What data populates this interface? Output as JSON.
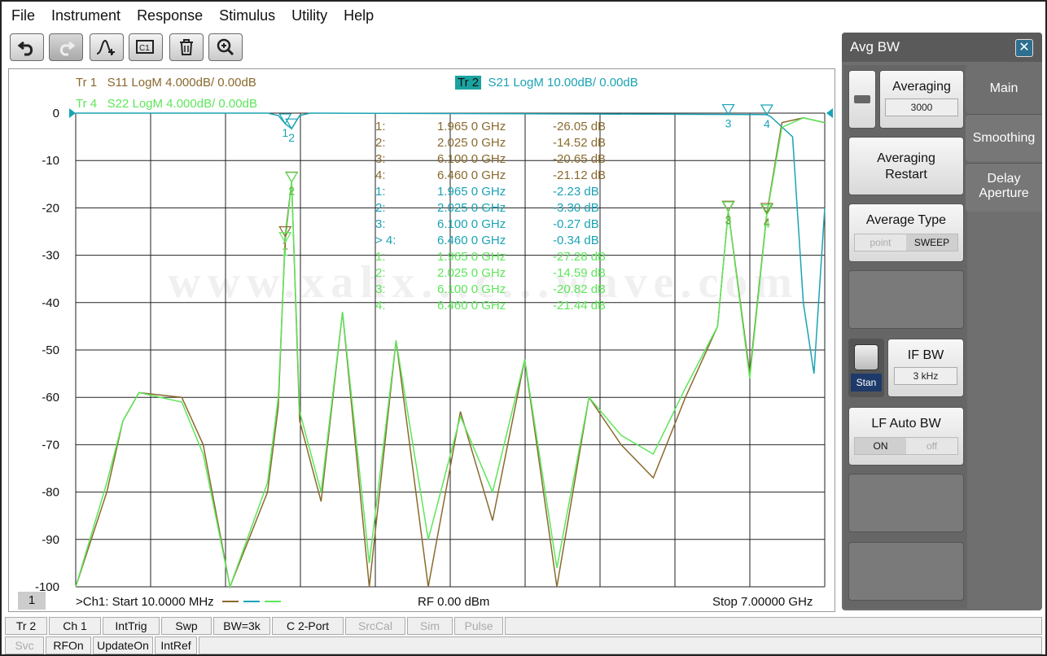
{
  "menu": [
    "File",
    "Instrument",
    "Response",
    "Stimulus",
    "Utility",
    "Help"
  ],
  "toolbar": {
    "icons": [
      "undo-icon",
      "redo-icon",
      "marker-add-icon",
      "calibration-icon",
      "trash-icon",
      "zoom-icon"
    ]
  },
  "colors": {
    "s11": "#8a6a2e",
    "s21": "#1aa3b5",
    "s22": "#5ee65a",
    "grid": "#222222",
    "tr2_badge": "#1aa3a0"
  },
  "traces": {
    "tr1": {
      "id": "Tr  1",
      "label": "S11 LogM 4.000dB/  0.00dB"
    },
    "tr2": {
      "id": "Tr  2",
      "label": "S21 LogM 10.00dB/  0.00dB"
    },
    "tr4": {
      "id": "Tr  4",
      "label": "S22 LogM 4.000dB/  0.00dB"
    }
  },
  "chart_data": {
    "type": "line",
    "xlim": [
      0.01,
      7.0
    ],
    "ylim": [
      -100,
      0
    ],
    "y_ticks": [
      "0",
      "-10",
      "-20",
      "-30",
      "-40",
      "-50",
      "-60",
      "-70",
      "-80",
      "-90",
      "-100"
    ],
    "grid": true,
    "series": [
      {
        "name": "S11",
        "x": [
          0.01,
          0.3,
          0.45,
          0.6,
          1.0,
          1.2,
          1.45,
          1.8,
          1.9,
          1.965,
          2.025,
          2.1,
          2.3,
          2.5,
          2.75,
          3.0,
          3.3,
          3.6,
          3.9,
          4.2,
          4.5,
          4.8,
          5.1,
          5.4,
          5.7,
          6.0,
          6.1,
          6.3,
          6.46,
          6.6,
          6.8,
          7.0
        ],
        "values": [
          -100,
          -80,
          -65,
          -59,
          -60,
          -70,
          -100,
          -80,
          -62,
          -26.05,
          -14.52,
          -65,
          -82,
          -42,
          -100,
          -48,
          -100,
          -63,
          -86,
          -52,
          -100,
          -60,
          -70,
          -77,
          -60,
          -45,
          -20.65,
          -55,
          -21.12,
          -2,
          -1,
          -2
        ]
      },
      {
        "name": "S21",
        "x": [
          0.01,
          1.8,
          1.9,
          1.965,
          2.025,
          2.1,
          2.2,
          6.1,
          6.3,
          6.4,
          6.46,
          6.5,
          6.7,
          6.8,
          6.9,
          7.0
        ],
        "values": [
          0,
          0,
          -0.5,
          -2.23,
          -3.3,
          -0.5,
          0,
          -0.27,
          -0.3,
          -0.3,
          -0.34,
          -0.8,
          -5,
          -40,
          -55,
          -20
        ]
      },
      {
        "name": "S22",
        "x": [
          0.01,
          0.3,
          0.45,
          0.6,
          1.0,
          1.2,
          1.45,
          1.8,
          1.9,
          1.965,
          2.025,
          2.1,
          2.3,
          2.5,
          2.75,
          3.0,
          3.3,
          3.6,
          3.9,
          4.2,
          4.5,
          4.8,
          5.1,
          5.4,
          5.7,
          6.0,
          6.1,
          6.3,
          6.46,
          6.6,
          6.8,
          7.0
        ],
        "values": [
          -100,
          -78,
          -65,
          -59,
          -61,
          -72,
          -100,
          -78,
          -60,
          -27.28,
          -14.59,
          -63,
          -80,
          -42,
          -95,
          -48,
          -90,
          -64,
          -80,
          -52,
          -96,
          -60,
          -68,
          -72,
          -58,
          -45,
          -20.82,
          -56,
          -21.44,
          -3,
          -1,
          -2
        ]
      }
    ]
  },
  "markers": [
    {
      "num": "1:",
      "freq": "1.965 0 GHz",
      "val": "-26.05 dB",
      "trace": "s11"
    },
    {
      "num": "2:",
      "freq": "2.025 0 GHz",
      "val": "-14.52 dB",
      "trace": "s11"
    },
    {
      "num": "3:",
      "freq": "6.100 0 GHz",
      "val": "-20.65 dB",
      "trace": "s11"
    },
    {
      "num": "4:",
      "freq": "6.460 0 GHz",
      "val": "-21.12 dB",
      "trace": "s11"
    },
    {
      "num": "1:",
      "freq": "1.965 0 GHz",
      "val": "-2.23 dB",
      "trace": "s21"
    },
    {
      "num": "2:",
      "freq": "2.025 0 GHz",
      "val": "-3.30 dB",
      "trace": "s21"
    },
    {
      "num": "3:",
      "freq": "6.100 0 GHz",
      "val": "-0.27 dB",
      "trace": "s21"
    },
    {
      "num": "> 4:",
      "freq": "6.460 0 GHz",
      "val": "-0.34 dB",
      "trace": "s21"
    },
    {
      "num": "1:",
      "freq": "1.965 0 GHz",
      "val": "-27.28 dB",
      "trace": "s22"
    },
    {
      "num": "2:",
      "freq": "2.025 0 GHz",
      "val": "-14.59 dB",
      "trace": "s22"
    },
    {
      "num": "3:",
      "freq": "6.100 0 GHz",
      "val": "-20.82 dB",
      "trace": "s22"
    },
    {
      "num": "4:",
      "freq": "6.460 0 GHz",
      "val": "-21.44 dB",
      "trace": "s22"
    }
  ],
  "marker_flags": [
    "1",
    "2",
    "3",
    "4"
  ],
  "watermark": "www.xahx...c...wave.com",
  "footer": {
    "channel": "1",
    "start": ">Ch1:  Start   10.0000 MHz",
    "rf": "RF    0.00 dBm",
    "stop": "Stop  7.00000 GHz"
  },
  "panel": {
    "title": "Avg BW",
    "close": "✕",
    "averaging": {
      "label": "Averaging",
      "value": "3000"
    },
    "restart": "Averaging Restart",
    "avg_type": {
      "label": "Average Type",
      "opt1": "point",
      "opt2": "SWEEP"
    },
    "ifbw": {
      "label": "IF BW",
      "value": "3 kHz",
      "toggle": "Stan"
    },
    "lfauto": {
      "label": "LF Auto BW",
      "on": "ON",
      "off": "off"
    },
    "tabs": [
      "Main",
      "Smoothing",
      "Delay Aperture"
    ]
  },
  "status1": [
    {
      "t": "Tr 2",
      "dim": false
    },
    {
      "t": "Ch 1",
      "dim": false
    },
    {
      "t": "IntTrig",
      "dim": false
    },
    {
      "t": "Swp",
      "dim": false
    },
    {
      "t": "BW=3k",
      "dim": false
    },
    {
      "t": "C  2-Port",
      "dim": false
    },
    {
      "t": "SrcCal",
      "dim": true
    },
    {
      "t": "Sim",
      "dim": true
    },
    {
      "t": "Pulse",
      "dim": true
    }
  ],
  "status2": [
    {
      "t": "Svc",
      "dim": true
    },
    {
      "t": "RFOn",
      "dim": false
    },
    {
      "t": "UpdateOn",
      "dim": false
    },
    {
      "t": "IntRef",
      "dim": false
    }
  ]
}
